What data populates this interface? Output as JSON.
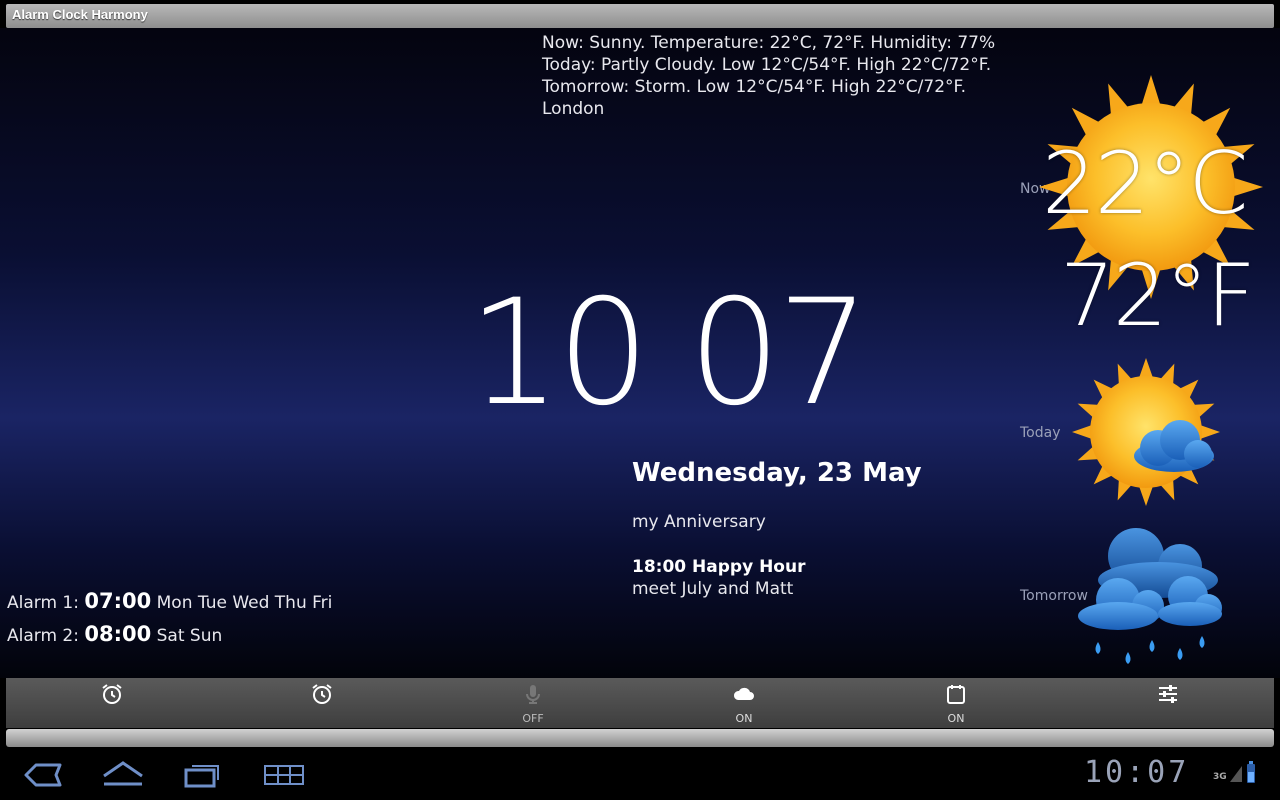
{
  "window": {
    "title": "Alarm Clock Harmony"
  },
  "weather": {
    "lines": [
      "Now: Sunny. Temperature: 22°C, 72°F. Humidity: 77%",
      "Today: Partly Cloudy. Low 12°C/54°F. High 22°C/72°F.",
      "Tomorrow: Storm. Low 12°C/54°F. High 22°C/72°F.",
      "London"
    ],
    "now_label": "Now",
    "today_label": "Today",
    "tomorrow_label": "Tomorrow",
    "temp_c": "22°C",
    "temp_f": "72°F",
    "now_icon": "sunny-icon",
    "today_icon": "partly-cloudy-icon",
    "tomorrow_icon": "storm-icon"
  },
  "clock": {
    "time": "10 07"
  },
  "calendar": {
    "date": "Wednesday, 23 May",
    "event1": "my Anniversary",
    "event2_title": "18:00 Happy Hour",
    "event2_desc": "meet July and Matt"
  },
  "alarms": [
    {
      "label": "Alarm 1:",
      "time": "07:00",
      "days": "Mon Tue Wed Thu Fri"
    },
    {
      "label": "Alarm 2:",
      "time": "08:00",
      "days": "Sat Sun"
    }
  ],
  "toolbar": {
    "items": [
      {
        "icon": "alarm-clock-icon",
        "label": ""
      },
      {
        "icon": "alarm-clock-icon",
        "label": ""
      },
      {
        "icon": "microphone-icon",
        "label": "OFF"
      },
      {
        "icon": "cloud-icon",
        "label": "ON"
      },
      {
        "icon": "calendar-icon",
        "label": "ON"
      },
      {
        "icon": "settings-sliders-icon",
        "label": ""
      }
    ]
  },
  "status_bar": {
    "time": "10:07",
    "network": "3G"
  },
  "colors": {
    "sun": "#f7b51c",
    "sun_core": "#ffd23a",
    "cloud": "#2e7fd6",
    "toolbar": "#4a4a4a",
    "background": "#0a0f33"
  }
}
